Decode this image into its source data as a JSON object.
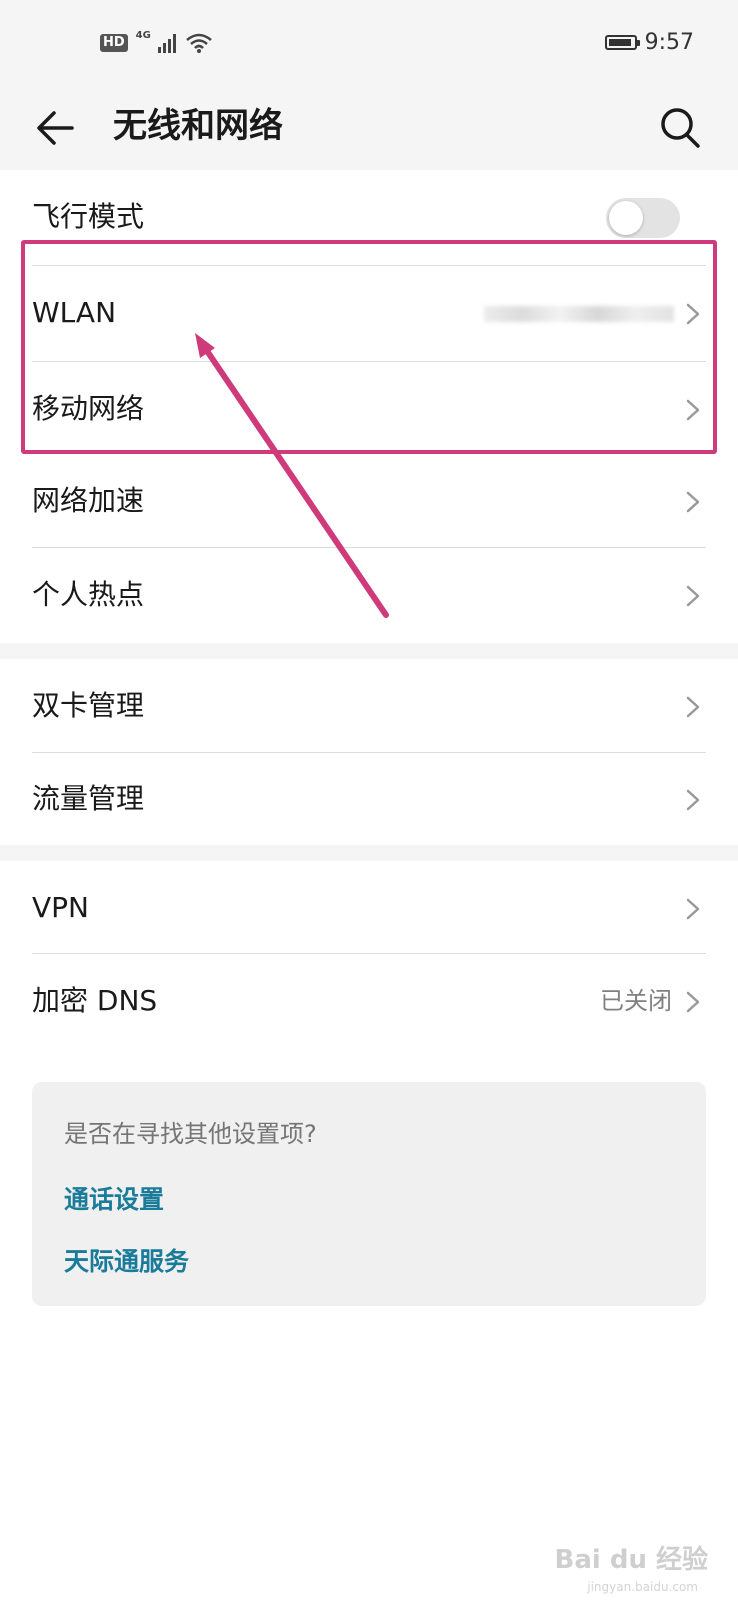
{
  "status_bar": {
    "hd": "HD",
    "network": "4G",
    "time": "9:57",
    "icons": [
      "signal-icon",
      "wifi-icon",
      "battery-icon"
    ]
  },
  "header": {
    "title": "无线和网络",
    "back_icon": "arrow-left-icon",
    "search_icon": "search-icon"
  },
  "group1": {
    "airplane_mode": {
      "label": "飞行模式",
      "enabled": false
    },
    "wlan": {
      "label": "WLAN"
    },
    "mobile_network": {
      "label": "移动网络"
    },
    "network_acceleration": {
      "label": "网络加速"
    },
    "personal_hotspot": {
      "label": "个人热点"
    }
  },
  "group2": {
    "dual_sim": {
      "label": "双卡管理"
    },
    "data_usage": {
      "label": "流量管理"
    }
  },
  "group3": {
    "vpn": {
      "label": "VPN"
    },
    "private_dns": {
      "label": "加密 DNS",
      "value": "已关闭"
    }
  },
  "suggestions": {
    "title": "是否在寻找其他设置项?",
    "links": [
      "通话设置",
      "天际通服务"
    ]
  },
  "watermark": {
    "text": "Bai du 经验",
    "sub": "jingyan.baidu.com"
  },
  "colors": {
    "accent_link": "#1a7b9a",
    "highlight": "#cf3a7a",
    "background": "#f5f5f5"
  }
}
